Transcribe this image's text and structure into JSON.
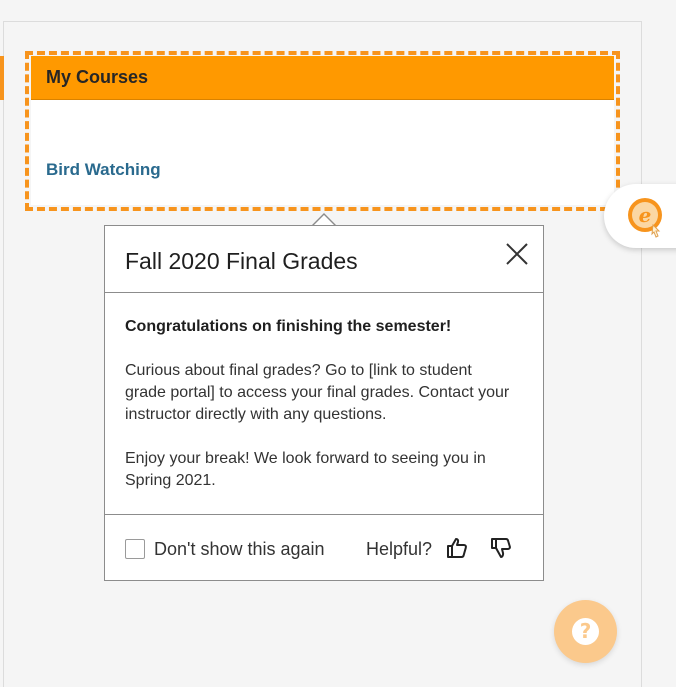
{
  "module": {
    "title": "My Courses",
    "courses": [
      {
        "label": "Bird Watching"
      }
    ]
  },
  "popover": {
    "title": "Fall 2020 Final Grades",
    "heading": "Congratulations on finishing the semester!",
    "paragraph1": "Curious about final grades? Go to [link to student grade portal] to access your final grades. Contact your instructor directly with any questions.",
    "paragraph2": "Enjoy your break! We look forward to seeing you in Spring 2021.",
    "dont_show_label": "Don't show this again",
    "dont_show_checked": false,
    "helpful_label": "Helpful?"
  },
  "help": {
    "glyph": "?"
  },
  "icons": {
    "side_badge": "e-badge-icon",
    "close": "close-icon",
    "thumb_up": "thumbs-up-icon",
    "thumb_down": "thumbs-down-icon",
    "help": "question-icon"
  },
  "colors": {
    "accent": "#ff9900",
    "accent_dashed": "#f7941d",
    "link": "#2a6a8e",
    "help_fab": "#fbc98c"
  }
}
